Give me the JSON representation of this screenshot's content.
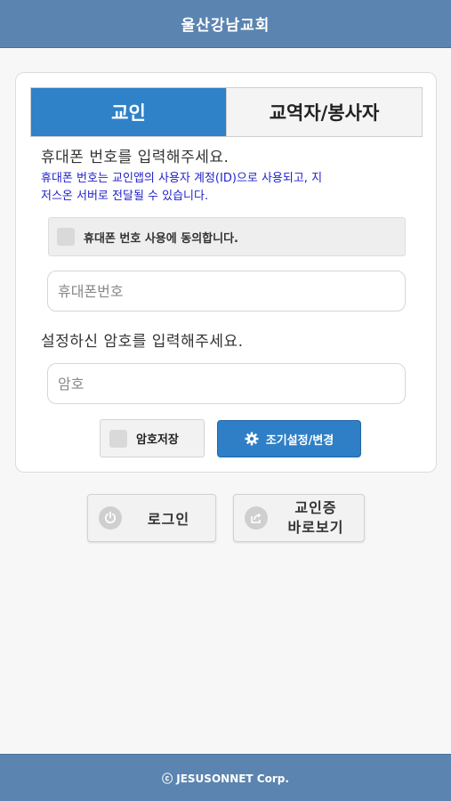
{
  "header": {
    "title": "울산강남교회"
  },
  "tabs": [
    {
      "label": "교인",
      "active": true
    },
    {
      "label": "교역자/봉사자",
      "active": false
    }
  ],
  "form": {
    "phone_prompt": "휴대폰 번호를 입력해주세요.",
    "phone_notice_line1": "휴대폰 번호는 교인앱의 사용자 계정(ID)으로 사용되고, 지",
    "phone_notice_line2": "저스온 서버로 전달될 수 있습니다.",
    "agree_label": "휴대폰 번호 사용에 동의합니다.",
    "phone_placeholder": "휴대폰번호",
    "phone_value": "",
    "password_prompt": "설정하신 암호를 입력해주세요.",
    "password_placeholder": "암호",
    "password_value": "",
    "save_password_label": "암호저장",
    "reset_button_label": "조기설정/변경"
  },
  "actions": {
    "login_label": "로그인",
    "member_card_line1": "교인증",
    "member_card_line2": "바로보기"
  },
  "footer": {
    "text": "ⓒ JESUSONNET Corp."
  },
  "colors": {
    "header_bg": "#5b84b0",
    "tab_active": "#2f81c8",
    "button_blue": "#2e7fc6",
    "notice_text": "#2222cc"
  },
  "icons": [
    "gear-icon",
    "power-icon",
    "share-icon",
    "copyright-icon"
  ]
}
